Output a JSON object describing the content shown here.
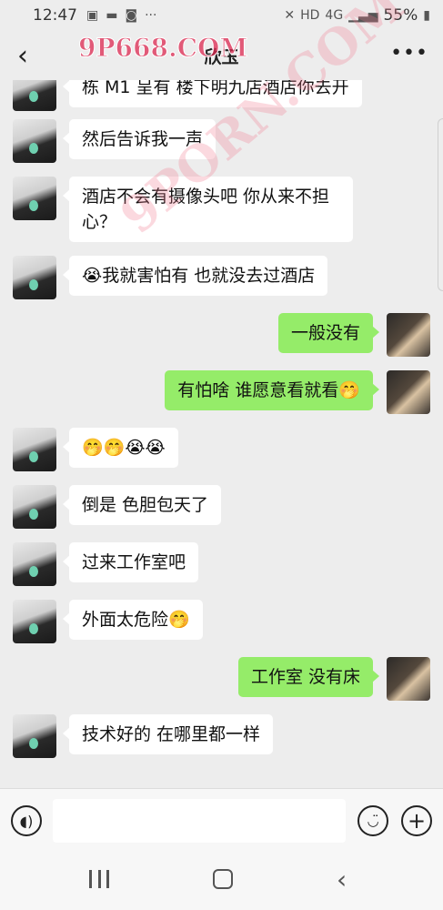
{
  "status": {
    "time": "12:47",
    "icons_left": [
      "image-icon",
      "chat-icon",
      "app-icon",
      "more-dots-icon"
    ],
    "network": "HD",
    "signal": "4G",
    "battery": "55%"
  },
  "header": {
    "title": "欣玉",
    "watermark": "9P668.COM",
    "watermark2": "9PORN.COM"
  },
  "messages": [
    {
      "side": "in",
      "text": "栋 M1 呈有  楼下明九店酒店你去开"
    },
    {
      "side": "in",
      "text": "然后告诉我一声"
    },
    {
      "side": "in",
      "text": "酒店不会有摄像头吧 你从来不担心？"
    },
    {
      "side": "in",
      "text": "😭我就害怕有 也就没去过酒店"
    },
    {
      "side": "out",
      "text": "一般没有"
    },
    {
      "side": "out",
      "text": "有怕啥 谁愿意看就看🤭"
    },
    {
      "side": "in",
      "text": "🤭🤭😭😭"
    },
    {
      "side": "in",
      "text": "倒是 色胆包天了"
    },
    {
      "side": "in",
      "text": "过来工作室吧"
    },
    {
      "side": "in",
      "text": "外面太危险🤭"
    },
    {
      "side": "out",
      "text": "工作室 没有床"
    },
    {
      "side": "in",
      "text": "技术好的 在哪里都一样"
    }
  ],
  "input": {
    "value": "",
    "placeholder": ""
  },
  "icons": {
    "back": "back-arrow-icon",
    "more": "more-icon",
    "voice": "voice-icon",
    "emoji": "emoji-icon",
    "plus": "plus-icon"
  }
}
